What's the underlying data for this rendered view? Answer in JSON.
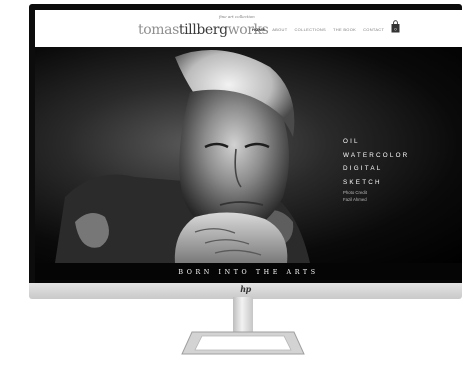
{
  "site": {
    "logo": {
      "part1": "tomas",
      "part2": "tillberg",
      "part3": "works"
    },
    "tagline": "fine art collection"
  },
  "nav": {
    "items": [
      "HOME",
      "ABOUT",
      "COLLECTIONS",
      "THE BOOK",
      "CONTACT"
    ],
    "active_index": 0,
    "cart_count": "0"
  },
  "hero": {
    "menu": [
      "OIL",
      "WATERCOLOR",
      "DIGITAL",
      "SKETCH"
    ],
    "credit_label": "Photo Credit",
    "credit_name": "Fazil Ahmed",
    "caption": "BORN INTO THE ARTS"
  },
  "monitor": {
    "brand": "hp"
  },
  "colors": {
    "background": "#ffffff",
    "screen_black": "#000000",
    "header_white": "#ffffff",
    "logo_dark": "#3a3a3a",
    "logo_light": "#8f8f8f"
  },
  "icons": [
    "shopping-bag-icon",
    "hp-logo-icon"
  ]
}
